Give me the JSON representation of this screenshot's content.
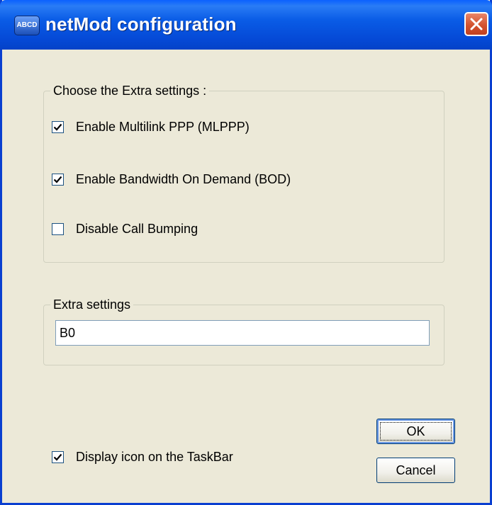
{
  "window": {
    "title": "netMod configuration",
    "app_icon_text": "ABCD"
  },
  "extra_group": {
    "legend": "Choose the Extra settings :",
    "options": [
      {
        "label": "Enable Multilink PPP (MLPPP)",
        "checked": true
      },
      {
        "label": "Enable Bandwidth On Demand (BOD)",
        "checked": true
      },
      {
        "label": "Disable Call Bumping",
        "checked": false
      }
    ]
  },
  "extra_settings": {
    "legend": "Extra settings",
    "value": "B0"
  },
  "taskbar_option": {
    "label": "Display icon on the TaskBar",
    "checked": true
  },
  "buttons": {
    "ok": "OK",
    "cancel": "Cancel"
  },
  "colors": {
    "titlebar": "#0549d6",
    "dialog": "#ece9d8",
    "close": "#d3532f",
    "check": "#21a121"
  }
}
